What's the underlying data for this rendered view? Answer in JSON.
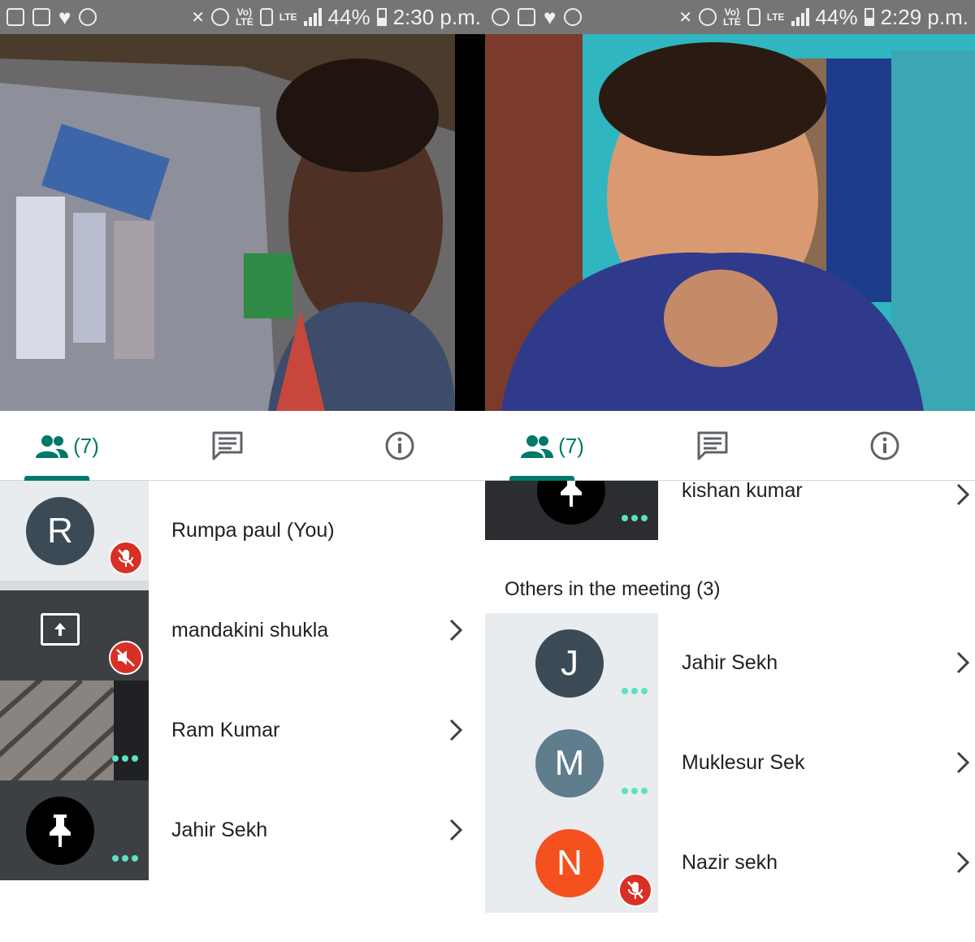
{
  "colors": {
    "accent": "#00796b",
    "mic_off": "#d93025",
    "status_bar": "#757575",
    "avatar_slate": "#3c4a55",
    "avatar_blue_grey": "#5f7d8c",
    "avatar_orange": "#f4511e",
    "dots": "#5de0c4"
  },
  "left": {
    "status": {
      "battery": "44%",
      "time": "2:30 p.m."
    },
    "tabs": {
      "people_count": "(7)"
    },
    "participants": [
      {
        "initial": "R",
        "name": "Rumpa paul (You)",
        "muted": true
      },
      {
        "name": "mandakini shukla",
        "icon": "present-icon",
        "muted": true
      },
      {
        "name": "Ram Kumar"
      },
      {
        "name": "Jahir Sekh",
        "icon": "pin-icon"
      }
    ]
  },
  "right": {
    "status": {
      "battery": "44%",
      "time": "2:29 p.m."
    },
    "tabs": {
      "people_count": "(7)"
    },
    "top_participant": {
      "name": "kishan kumar",
      "icon": "pin-icon"
    },
    "others_heading": "Others in the meeting (3)",
    "others": [
      {
        "initial": "J",
        "name": "Jahir Sekh"
      },
      {
        "initial": "M",
        "name": "Muklesur Sek"
      },
      {
        "initial": "N",
        "name": "Nazir sekh",
        "muted": true
      }
    ]
  }
}
